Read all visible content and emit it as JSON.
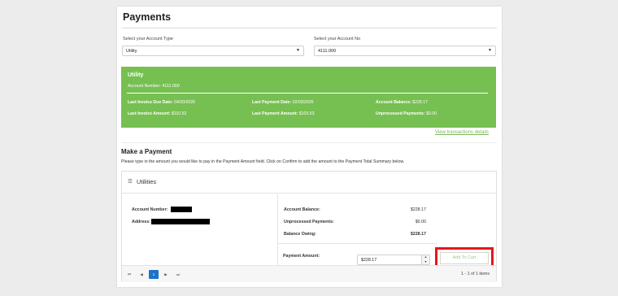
{
  "page": {
    "title": "Payments"
  },
  "filters": {
    "account_type_label": "Select your Account Type",
    "account_type_value": "Utility",
    "account_no_label": "Select your Account No",
    "account_no_value": "4111.000"
  },
  "summary": {
    "title": "Utility",
    "account_number": "Account Number: 4111.000",
    "due_date_label": "Last Invoice Due Date:",
    "due_date": "04/30/2026",
    "pay_date_label": "Last Payment Date:",
    "pay_date": "02/03/2026",
    "balance_label": "Account Balance:",
    "balance": "$228.17",
    "inv_amt_label": "Last Invoice Amount:",
    "inv_amt": "$110.52",
    "pay_amt_label": "Last Payment Amount:",
    "pay_amt": "$103.53",
    "unproc_label": "Unprocessed Payments:",
    "unproc": "$0.00",
    "accent": "#76bf51"
  },
  "link": {
    "view_transactions": "View transactions details"
  },
  "make_payment": {
    "heading": "Make a Payment",
    "instructions": "Please type in the amount you would like to pay in the Payment Amount field. Click on Confirm to add the amount to the Payment Total Summary below."
  },
  "card": {
    "title": "Utilities",
    "title_icon": "list-icon",
    "account_number_label": "Account Number:",
    "address_label": "Address:",
    "balance_label": "Account Balance:",
    "balance": "$228.17",
    "unproc_label": "Unprocessed Payments:",
    "unproc": "$0.00",
    "owing_label": "Balance Owing:",
    "owing": "$228.17",
    "pay_amount_label": "Payment Amount:",
    "pay_amount": "$228.17",
    "add_to_cart": "Add To Cart",
    "highlight_color": "#e8141a"
  },
  "pager": {
    "first": "⏮",
    "prev": "◀",
    "current": "1",
    "next": "▶",
    "last": "⏭",
    "info": "1 - 1 of 1 items",
    "active_color": "#1e73c8"
  }
}
